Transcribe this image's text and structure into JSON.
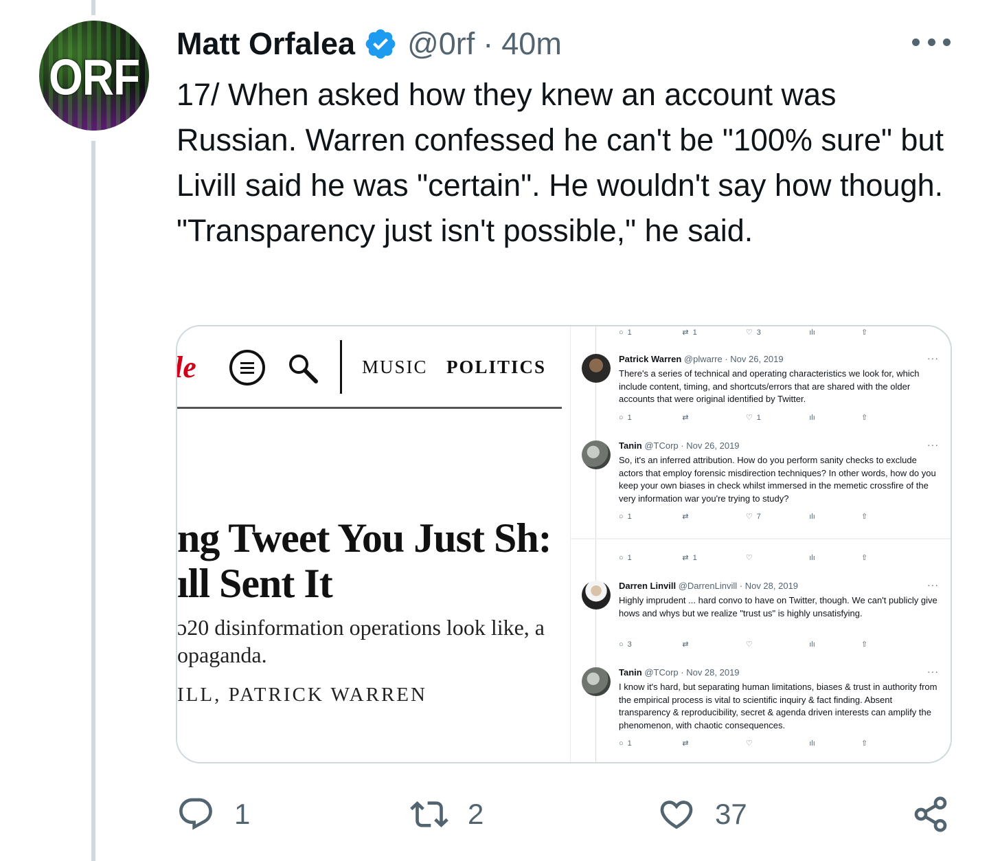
{
  "author": {
    "name": "Matt Orfalea",
    "handle": "@0rf",
    "separator": "·",
    "time": "40m",
    "avatar_text": "ORF",
    "verified": true
  },
  "tweet": {
    "text": "17/ When asked how they knew an account was Russian. Warren confessed he can't be \"100% sure\" but Livill said he was \"certain\". He wouldn't say how though. \"Transparency just isn't possible,\" he said."
  },
  "article": {
    "logo_fragment": "le",
    "nav": [
      "MUSIC",
      "POLITICS"
    ],
    "headline_line1": "ng Tweet You Just Sh:",
    "headline_line2": "ıll Sent It",
    "subhead_line1": "ɔ20 disinformation operations look like, a",
    "subhead_line2": "opaganda.",
    "byline": "ILL, PATRICK WARREN"
  },
  "screenshot": {
    "top_actions": {
      "reply": "1",
      "retweet": "1",
      "like": "3"
    },
    "replies_top": [
      {
        "name": "Patrick Warren",
        "meta": "@plwarre · Nov 26, 2019",
        "body": "There's a series of technical and operating characteristics we look for, which include content, timing, and shortcuts/errors that are shared with the older accounts that were original identified by Twitter.",
        "reply": "1",
        "retweet": "",
        "like": "1"
      },
      {
        "name": "Tanin",
        "meta": "@TCorp · Nov 26, 2019",
        "body": "So, it's an inferred attribution. How do you perform sanity checks to exclude actors that employ forensic misdirection techniques? In other words, how do you keep your own biases in check whilst immersed in the memetic crossfire of the very information war you're trying to study?",
        "reply": "1",
        "retweet": "",
        "like": "7"
      }
    ],
    "mid_actions": {
      "reply": "1",
      "retweet": "1",
      "like": ""
    },
    "replies_bottom": [
      {
        "name": "Darren Linvill",
        "meta": "@DarrenLinvill · Nov 28, 2019",
        "body": "Highly imprudent ... hard convo to have on Twitter, though. We can't publicly give hows and whys but we realize \"trust us\" is highly unsatisfying.",
        "reply": "3",
        "retweet": "",
        "like": ""
      },
      {
        "name": "Tanin",
        "meta": "@TCorp · Nov 28, 2019",
        "body": "I know it's hard, but separating human limitations, biases & trust in authority from the empirical process is vital to scientific inquiry & fact finding. Absent transparency & reproducibility, secret & agenda driven interests can amplify the phenomenon, with chaotic consequences.",
        "reply": "1",
        "retweet": "",
        "like": ""
      }
    ]
  },
  "actions": {
    "replies": "1",
    "retweets": "2",
    "likes": "37"
  },
  "colors": {
    "text": "#0f1419",
    "secondary": "#536471",
    "verified": "#1d9bf0",
    "border": "#cfd9de"
  },
  "icons": [
    "verified-badge-icon",
    "more-icon",
    "reply-icon",
    "retweet-icon",
    "like-icon",
    "share-icon"
  ]
}
